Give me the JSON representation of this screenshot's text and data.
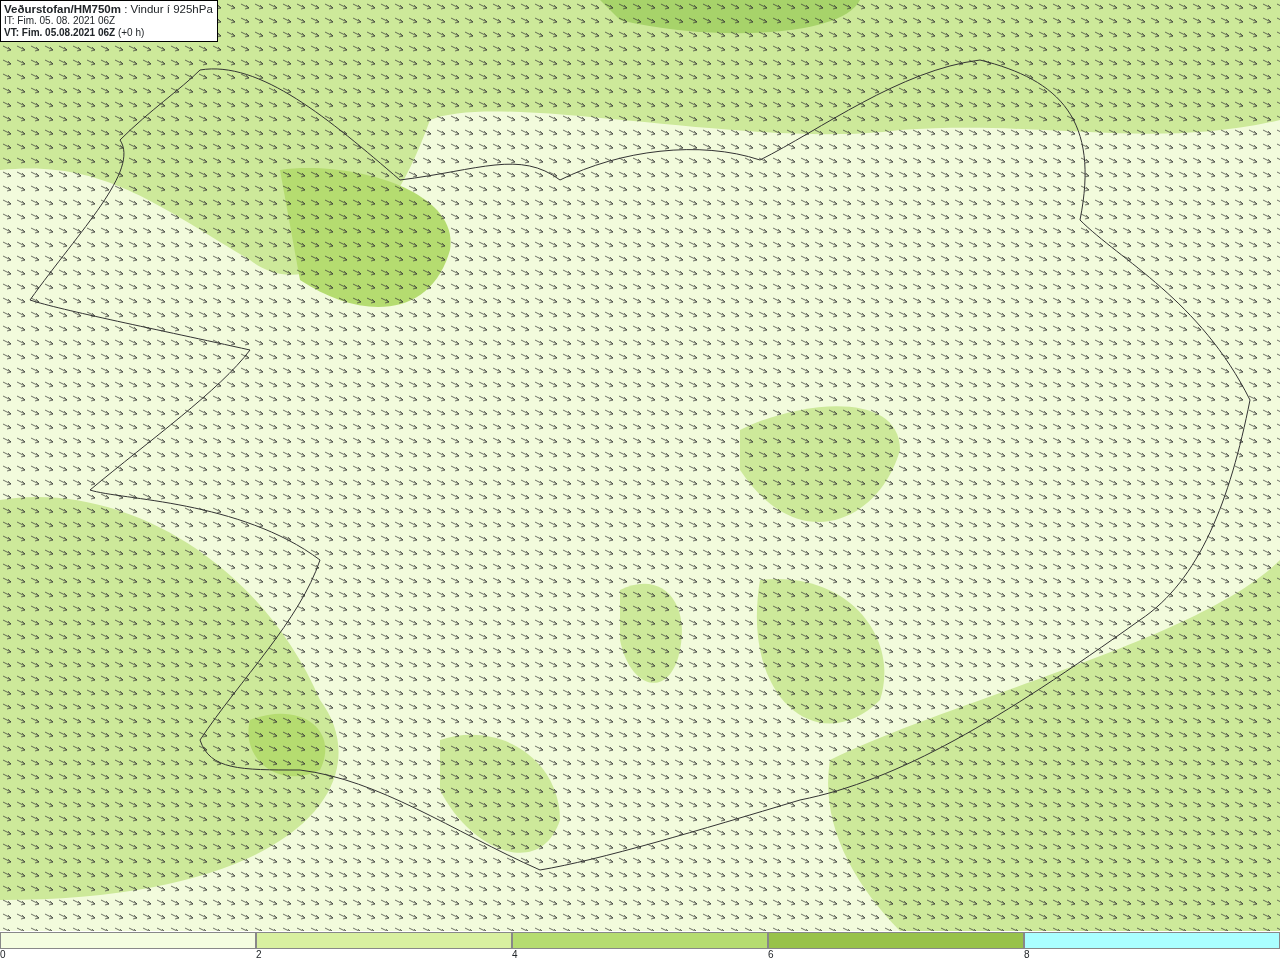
{
  "title_box": {
    "lines": [
      "**Veðurstofan/HM750m** : Vindur í 925hPa",
      "IT: Fim. 05. 08. 2021 06Z",
      "**VT: Fim. 05.08.2021 06Z** (+0 h)"
    ]
  },
  "legend": {
    "bins": [
      {
        "color": "#f4fde0"
      },
      {
        "color": "#d8f0a0"
      },
      {
        "color": "#b5dc70"
      },
      {
        "color": "#98c24a"
      },
      {
        "color": "#aaffff"
      }
    ],
    "ticks": [
      "0",
      "2",
      "4",
      "6",
      "8"
    ]
  }
}
